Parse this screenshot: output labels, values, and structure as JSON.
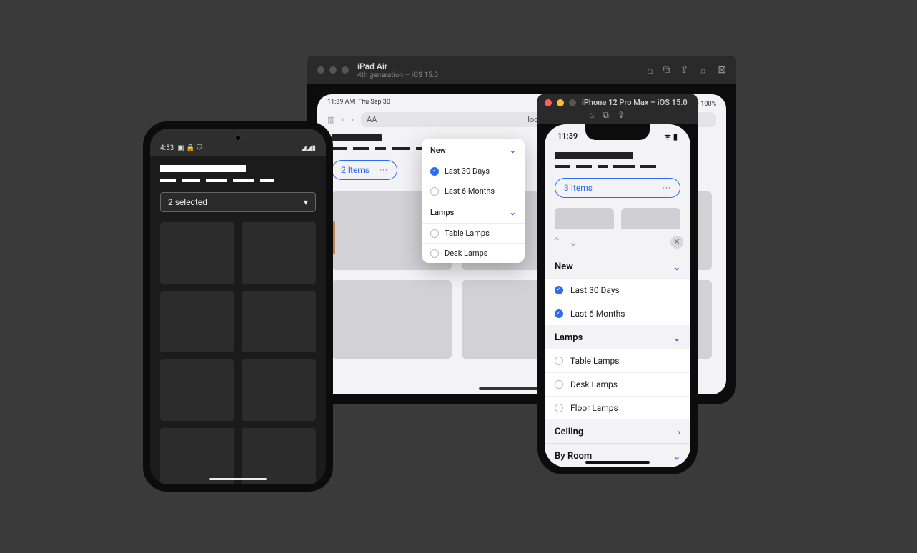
{
  "ipad": {
    "titlebar": {
      "title": "iPad Air",
      "subtitle": "4th generation – iOS 15.0"
    },
    "status": {
      "time": "11:39 AM",
      "date": "Thu Sep 30"
    },
    "url_label_left": "AA",
    "url": "localhost",
    "filter_summary": "2 Items",
    "popover": {
      "sec1_title": "New",
      "sec1_items": [
        "Last 30 Days",
        "Last 6 Months"
      ],
      "sec1_checked_index": 0,
      "sec2_title": "Lamps",
      "sec2_items": [
        "Table Lamps",
        "Desk Lamps"
      ]
    }
  },
  "iphone": {
    "titlebar": {
      "title": "iPhone 12 Pro Max – iOS 15.0"
    },
    "status": {
      "time": "11:39"
    },
    "filter_summary": "3 Items",
    "sheet": {
      "sec_new": {
        "title": "New",
        "items": [
          "Last 30 Days",
          "Last 6 Months"
        ],
        "checked": [
          0,
          1
        ]
      },
      "sec_lamps": {
        "title": "Lamps",
        "items": [
          "Table Lamps",
          "Desk Lamps",
          "Floor Lamps"
        ]
      },
      "sec_ceiling": {
        "title": "Ceiling"
      },
      "sec_byroom": {
        "title": "By Room"
      }
    }
  },
  "android": {
    "status": {
      "time": "4:53"
    },
    "select_label": "2 selected"
  },
  "glyphs": {
    "home": "⌂",
    "screenshot": "⧉",
    "share": "⇪",
    "brightness": "☼",
    "close_sq": "⊠",
    "chev_left": "‹",
    "chev_right": "›",
    "chev_down": "⌄",
    "chev_up": "⌃",
    "dots": "···",
    "x": "✕",
    "triangle_down": "▾",
    "signal": "▲◢",
    "wifi": "≋",
    "batt": "▮",
    "lock": "🔒",
    "shield": "⛉"
  }
}
